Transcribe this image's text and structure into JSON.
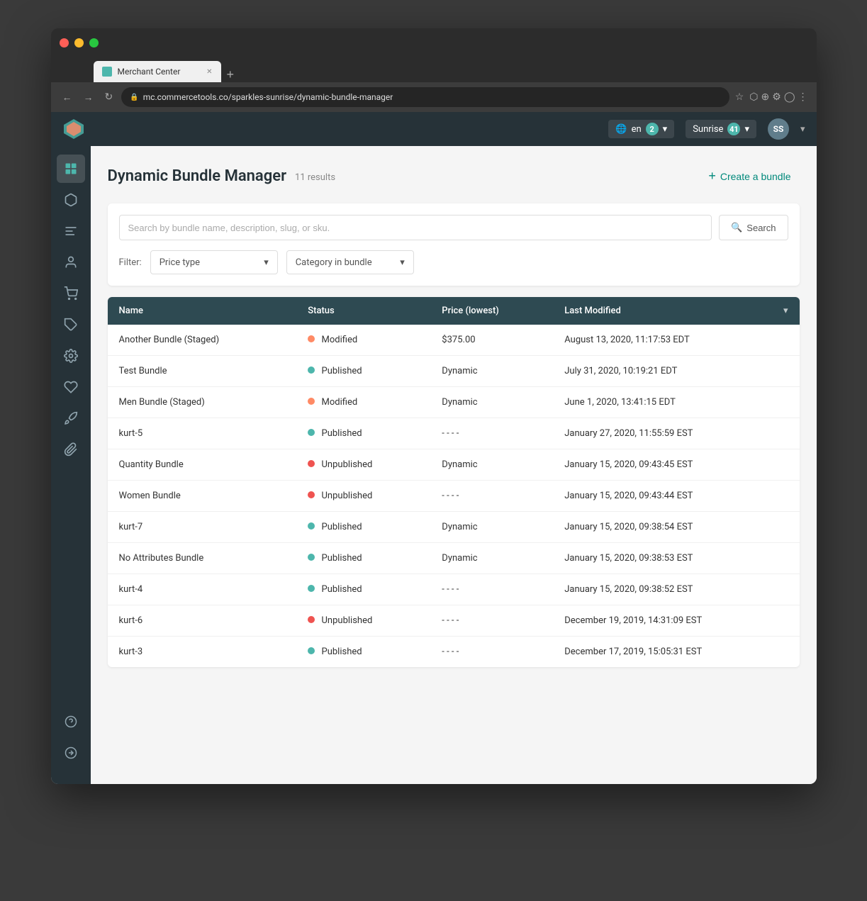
{
  "browser": {
    "url": "mc.commercetools.co/sparkles-sunrise/dynamic-bundle-manager",
    "tab_title": "Merchant Center",
    "traffic_lights": [
      "red",
      "yellow",
      "green"
    ]
  },
  "topbar": {
    "lang": "en",
    "lang_badge": "2",
    "project": "Sunrise",
    "project_badge": "41",
    "user_initials": "SS"
  },
  "page": {
    "title": "Dynamic Bundle Manager",
    "results": "11 results",
    "create_bundle_label": "Create a bundle"
  },
  "search": {
    "placeholder": "Search by bundle name, description, slug, or sku.",
    "button_label": "Search"
  },
  "filters": {
    "label": "Filter:",
    "price_type_placeholder": "Price type",
    "category_placeholder": "Category in bundle"
  },
  "table": {
    "columns": [
      "Name",
      "Status",
      "Price (lowest)",
      "Last Modified"
    ],
    "rows": [
      {
        "name": "Another Bundle (Staged)",
        "status": "Modified",
        "status_type": "orange",
        "price": "$375.00",
        "last_modified": "August 13, 2020, 11:17:53 EDT"
      },
      {
        "name": "Test Bundle",
        "status": "Published",
        "status_type": "green",
        "price": "Dynamic",
        "last_modified": "July 31, 2020, 10:19:21 EDT"
      },
      {
        "name": "Men Bundle (Staged)",
        "status": "Modified",
        "status_type": "orange",
        "price": "Dynamic",
        "last_modified": "June 1, 2020, 13:41:15 EDT"
      },
      {
        "name": "kurt-5",
        "status": "Published",
        "status_type": "green",
        "price": "- - - -",
        "last_modified": "January 27, 2020, 11:55:59 EST"
      },
      {
        "name": "Quantity Bundle",
        "status": "Unpublished",
        "status_type": "red",
        "price": "Dynamic",
        "last_modified": "January 15, 2020, 09:43:45 EST"
      },
      {
        "name": "Women Bundle",
        "status": "Unpublished",
        "status_type": "red",
        "price": "- - - -",
        "last_modified": "January 15, 2020, 09:43:44 EST"
      },
      {
        "name": "kurt-7",
        "status": "Published",
        "status_type": "green",
        "price": "Dynamic",
        "last_modified": "January 15, 2020, 09:38:54 EST"
      },
      {
        "name": "No Attributes Bundle",
        "status": "Published",
        "status_type": "green",
        "price": "Dynamic",
        "last_modified": "January 15, 2020, 09:38:53 EST"
      },
      {
        "name": "kurt-4",
        "status": "Published",
        "status_type": "green",
        "price": "- - - -",
        "last_modified": "January 15, 2020, 09:38:52 EST"
      },
      {
        "name": "kurt-6",
        "status": "Unpublished",
        "status_type": "red",
        "price": "- - - -",
        "last_modified": "December 19, 2019, 14:31:09 EST"
      },
      {
        "name": "kurt-3",
        "status": "Published",
        "status_type": "green",
        "price": "- - - -",
        "last_modified": "December 17, 2019, 15:05:31 EST"
      }
    ]
  },
  "sidebar": {
    "icons": [
      {
        "name": "dashboard-icon",
        "symbol": "⊞"
      },
      {
        "name": "products-icon",
        "symbol": "📦"
      },
      {
        "name": "categories-icon",
        "symbol": "⊞"
      },
      {
        "name": "customers-icon",
        "symbol": "👤"
      },
      {
        "name": "orders-icon",
        "symbol": "🛒"
      },
      {
        "name": "promotions-icon",
        "symbol": "🏷"
      },
      {
        "name": "settings-icon",
        "symbol": "⚙"
      },
      {
        "name": "wishlist-icon",
        "symbol": "♥"
      },
      {
        "name": "deploy-icon",
        "symbol": "🚀"
      },
      {
        "name": "attachments-icon",
        "symbol": "📎"
      }
    ],
    "bottom_icons": [
      {
        "name": "help-icon",
        "symbol": "?"
      },
      {
        "name": "forward-icon",
        "symbol": "→"
      }
    ]
  }
}
